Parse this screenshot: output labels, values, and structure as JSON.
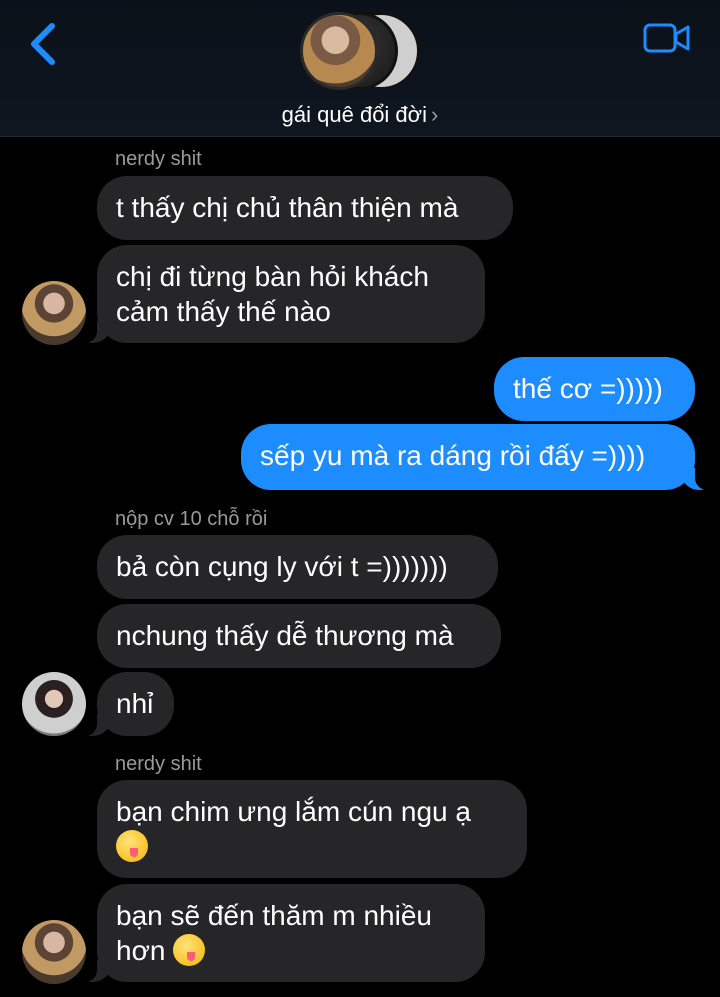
{
  "header": {
    "title": "gái quê đổi đời",
    "chevron": "›",
    "back_icon": "chevron-left-icon",
    "video_icon": "video-camera-icon",
    "accent": "#1c8cff"
  },
  "messages": {
    "s1": "nerdy shit",
    "m1": "t thấy chị chủ thân thiện mà",
    "m2": "chị đi từng bàn hỏi khách\ncảm thấy thế nào",
    "m3": "thế cơ =)))))",
    "m4": "sếp yu mà ra dáng rồi đấy =))))",
    "s2": "nộp cv 10 chỗ rồi",
    "m5": "bả còn cụng ly với t =)))))))",
    "m6": "nchung thấy dễ thương mà",
    "m7": "nhỉ",
    "s3": "nerdy shit",
    "m8": "bạn chim ưng lắm cún ngu ạ",
    "m9a": "bạn sẽ đến thăm m nhiều",
    "m9b": "hơn"
  },
  "colors": {
    "incoming_bubble": "#262628",
    "outgoing_bubble": "#1c8cff",
    "background": "#000000"
  }
}
